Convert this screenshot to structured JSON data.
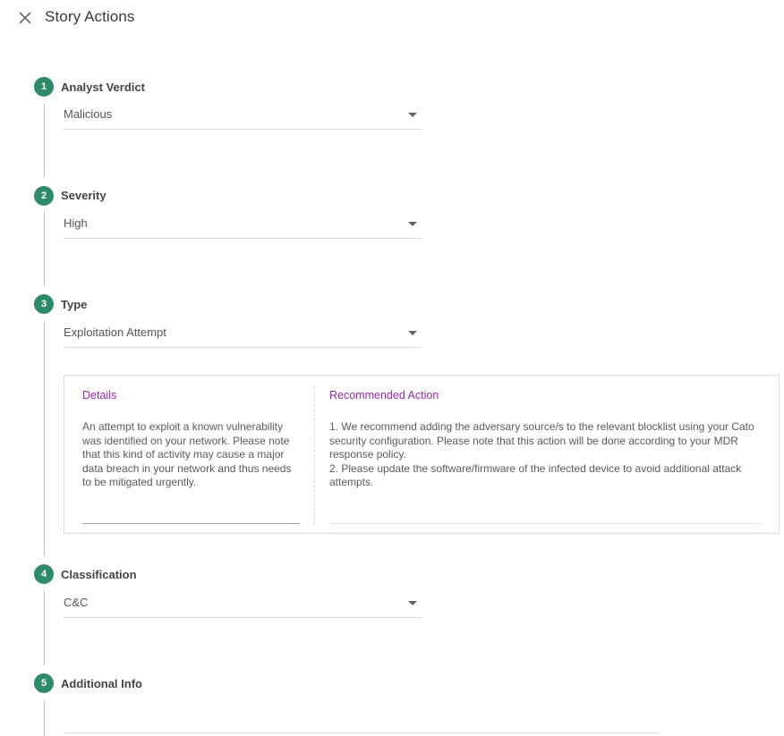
{
  "header": {
    "title": "Story Actions",
    "close_icon": "close-icon"
  },
  "steps": [
    {
      "number": "1",
      "label": "Analyst Verdict",
      "value": "Malicious"
    },
    {
      "number": "2",
      "label": "Severity",
      "value": "High"
    },
    {
      "number": "3",
      "label": "Type",
      "value": "Exploitation Attempt"
    },
    {
      "number": "4",
      "label": "Classification",
      "value": "C&C"
    },
    {
      "number": "5",
      "label": "Additional Info",
      "value": ""
    }
  ],
  "type_info": {
    "details_heading": "Details",
    "details_text": "An attempt to exploit a known vulnerability was identified on your network. Please note that this kind of activity may cause a major data breach in your network and thus needs to be mitigated urgently.",
    "recommended_heading": "Recommended Action",
    "recommended_line1": "1. We recommend adding the adversary source/s to the relevant blocklist using your Cato security configuration. Please note that this action will be done according to your MDR response policy.",
    "recommended_line2": "2. Please update the software/firmware of the infected device to avoid additional attack attempts."
  },
  "colors": {
    "step_circle": "#2f8a66",
    "panel_heading": "#9c27b0"
  }
}
